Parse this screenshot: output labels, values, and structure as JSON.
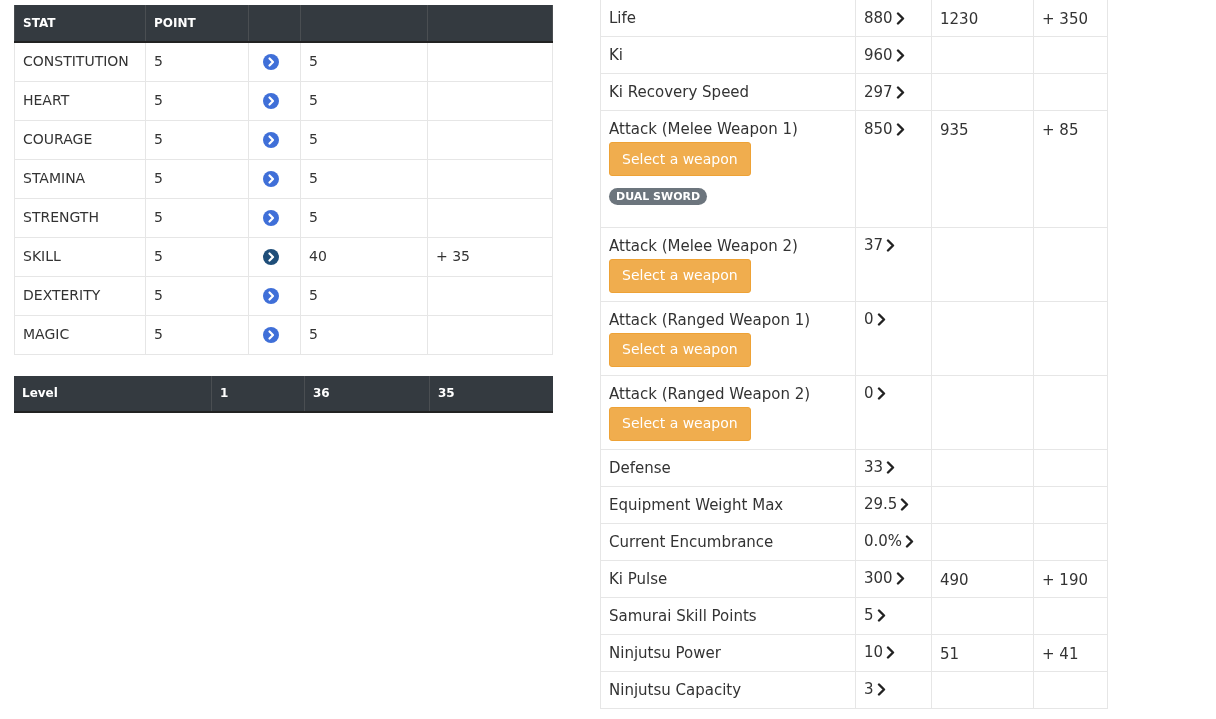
{
  "stat_table": {
    "columns": [
      "STAT",
      "POINT"
    ],
    "rows": [
      {
        "stat": "CONSTITUTION",
        "point": "5",
        "value": "5",
        "bonus": "",
        "highlighted": false
      },
      {
        "stat": "HEART",
        "point": "5",
        "value": "5",
        "bonus": "",
        "highlighted": false
      },
      {
        "stat": "COURAGE",
        "point": "5",
        "value": "5",
        "bonus": "",
        "highlighted": false
      },
      {
        "stat": "STAMINA",
        "point": "5",
        "value": "5",
        "bonus": "",
        "highlighted": false
      },
      {
        "stat": "STRENGTH",
        "point": "5",
        "value": "5",
        "bonus": "",
        "highlighted": false
      },
      {
        "stat": "SKILL",
        "point": "5",
        "value": "40",
        "bonus": "+ 35",
        "highlighted": true
      },
      {
        "stat": "DEXTERITY",
        "point": "5",
        "value": "5",
        "bonus": "",
        "highlighted": false
      },
      {
        "stat": "MAGIC",
        "point": "5",
        "value": "5",
        "bonus": "",
        "highlighted": false
      }
    ]
  },
  "level_bar": {
    "label": "Level",
    "base": "1",
    "current": "36",
    "gain": "35"
  },
  "attributes": [
    {
      "name": "Life",
      "base": "880",
      "current": "1230",
      "gain": "+ 350"
    },
    {
      "name": "Ki",
      "base": "960"
    },
    {
      "name": "Ki Recovery Speed",
      "base": "297"
    },
    {
      "name": "Attack (Melee Weapon 1)",
      "base": "850",
      "current": "935",
      "gain": "+ 85",
      "button": "Select a weapon",
      "tag": "DUAL SWORD"
    },
    {
      "name": "Attack (Melee Weapon 2)",
      "base": "37",
      "button": "Select a weapon"
    },
    {
      "name": "Attack (Ranged Weapon 1)",
      "base": "0",
      "button": "Select a weapon"
    },
    {
      "name": "Attack (Ranged Weapon 2)",
      "base": "0",
      "button": "Select a weapon"
    },
    {
      "name": "Defense",
      "base": "33"
    },
    {
      "name": "Equipment Weight Max",
      "base": "29.5"
    },
    {
      "name": "Current Encumbrance",
      "base": "0.0%"
    },
    {
      "name": "Ki Pulse",
      "base": "300",
      "current": "490",
      "gain": "+ 190"
    },
    {
      "name": "Samurai Skill Points",
      "base": "5"
    },
    {
      "name": "Ninjutsu Power",
      "base": "10",
      "current": "51",
      "gain": "+ 41"
    },
    {
      "name": "Ninjutsu Capacity",
      "base": "3"
    }
  ]
}
